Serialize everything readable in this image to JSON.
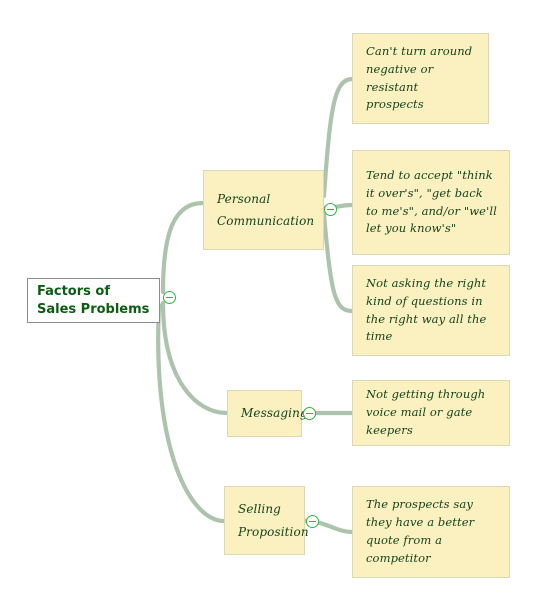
{
  "diagram": {
    "type": "mind-map",
    "background_color": "#ffffff",
    "connector_color": "#aec3ae",
    "note_fill_color": "#faf0c0",
    "note_border_color": "#ddd8b4",
    "text_color": "#14431a",
    "root_text_color": "#0c5c13",
    "collapse_icon_color": "#35b24a"
  },
  "root": {
    "label": "Factors of Sales Problems",
    "collapse_icon": "collapse-minus-icon"
  },
  "branches": [
    {
      "id": "personal-communication",
      "label": "Personal Communication",
      "collapse_icon": "collapse-minus-icon",
      "children": [
        {
          "id": "negative-prospects",
          "label": "Can't turn around negative or resistant prospects"
        },
        {
          "id": "tend-to-accept",
          "label": "Tend to accept \"think it over's\", \"get back to me's\", and/or \"we'll let you know's\""
        },
        {
          "id": "right-questions",
          "label": "Not asking the right kind of questions in the right way all the time"
        }
      ]
    },
    {
      "id": "messaging",
      "label": "Messaging",
      "collapse_icon": "collapse-minus-icon",
      "children": [
        {
          "id": "voice-mail-gatekeepers",
          "label": "Not getting through voice mail or gate keepers"
        }
      ]
    },
    {
      "id": "selling-proposition",
      "label": "Selling Proposition",
      "collapse_icon": "collapse-minus-icon",
      "children": [
        {
          "id": "better-quote",
          "label": "The prospects say they have a better quote from a competitor"
        }
      ]
    }
  ]
}
